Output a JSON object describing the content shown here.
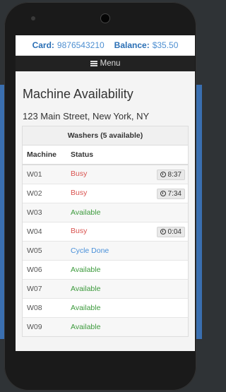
{
  "header": {
    "card_label": "Card:",
    "card_value": "9876543210",
    "balance_label": "Balance:",
    "balance_value": "$35.50"
  },
  "menu": {
    "label": "Menu"
  },
  "page": {
    "title": "Machine Availability",
    "address": "123 Main Street, New York, NY"
  },
  "washers": {
    "heading": "Washers (5 available)",
    "col_machine": "Machine",
    "col_status": "Status",
    "rows": [
      {
        "machine": "W01",
        "status": "Busy",
        "timer": "8:37"
      },
      {
        "machine": "W02",
        "status": "Busy",
        "timer": "7:34"
      },
      {
        "machine": "W03",
        "status": "Available",
        "timer": ""
      },
      {
        "machine": "W04",
        "status": "Busy",
        "timer": "0:04"
      },
      {
        "machine": "W05",
        "status": "Cycle Done",
        "timer": ""
      },
      {
        "machine": "W06",
        "status": "Available",
        "timer": ""
      },
      {
        "machine": "W07",
        "status": "Available",
        "timer": ""
      },
      {
        "machine": "W08",
        "status": "Available",
        "timer": ""
      },
      {
        "machine": "W09",
        "status": "Available",
        "timer": ""
      }
    ]
  },
  "icons": {
    "menu": "hamburger-icon",
    "timer": "clock-icon"
  }
}
